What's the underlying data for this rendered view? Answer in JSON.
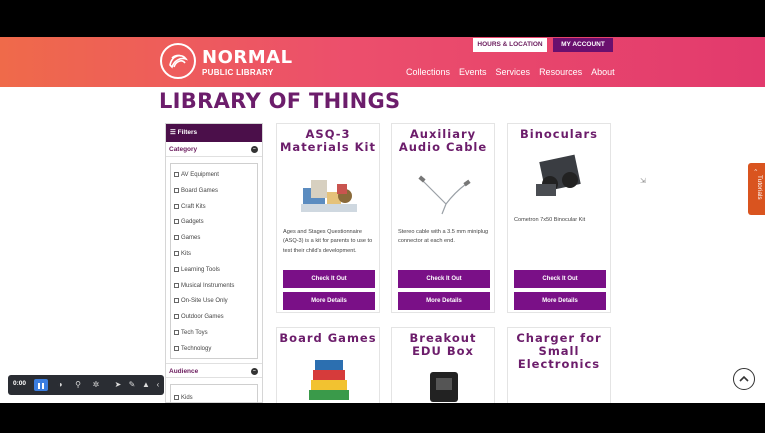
{
  "header": {
    "logo_name": "NORMAL",
    "logo_sub": "PUBLIC LIBRARY",
    "hours_button": "HOURS & LOCATION",
    "account_button": "MY ACCOUNT",
    "nav": [
      "Collections",
      "Events",
      "Services",
      "Resources",
      "About"
    ],
    "gradient_start": "#ef6a4a",
    "gradient_end": "#e23a6d"
  },
  "page_title": "LIBRARY OF THINGS",
  "filters": {
    "heading": "Filters",
    "category_label": "Category",
    "categories": [
      "AV Equipment",
      "Board Games",
      "Craft Kits",
      "Gadgets",
      "Games",
      "Kits",
      "Learning Tools",
      "Musical Instruments",
      "On-Site Use Only",
      "Outdoor Games",
      "Tech Toys",
      "Technology"
    ],
    "audience_label": "Audience",
    "audiences": [
      "Kids"
    ]
  },
  "cards": [
    {
      "title": "ASQ-3 Materials Kit",
      "description": "Ages and Stages Questionnaire (ASQ-3) is a kit for parents to use to test their child's development.",
      "check_out": "Check It Out",
      "details": "More Details"
    },
    {
      "title": "Auxiliary Audio Cable",
      "description": "Stereo cable with a 3.5 mm miniplug connector at each end.",
      "check_out": "Check It Out",
      "details": "More Details"
    },
    {
      "title": "Binoculars",
      "description": "Cometron 7x50 Binocular Kit",
      "check_out": "Check It Out",
      "details": "More Details"
    },
    {
      "title": "Board Games"
    },
    {
      "title": "Breakout EDU Box"
    },
    {
      "title": "Charger for Small Electronics"
    }
  ],
  "tutorials_tab": "Tutorials",
  "recorder": {
    "time": "0:00"
  },
  "colors": {
    "brand_purple": "#6c1d6b",
    "button_purple": "#7a1087",
    "tutorials_orange": "#d9541f"
  }
}
